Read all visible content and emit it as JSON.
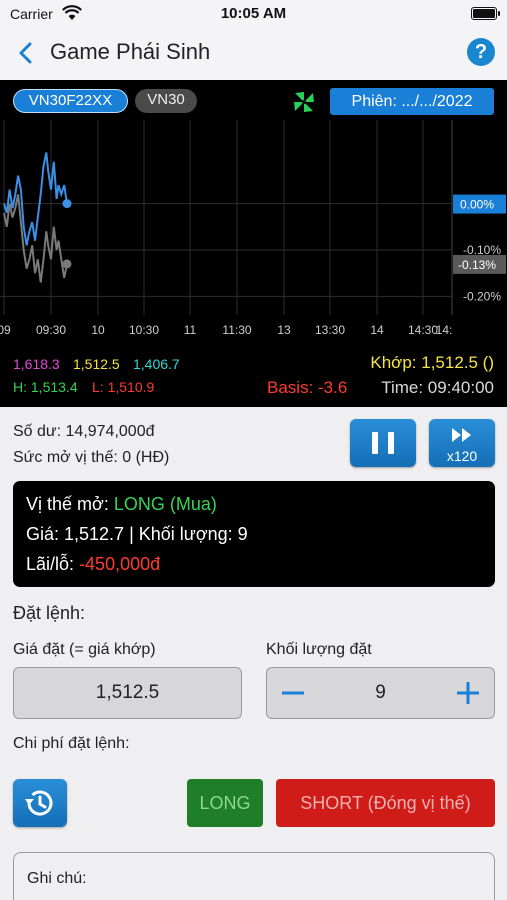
{
  "status_bar": {
    "carrier": "Carrier",
    "time": "10:05 AM"
  },
  "nav": {
    "title": "Game Phái Sinh",
    "help": "?"
  },
  "ticker": {
    "symbols": [
      "VN30F22XX",
      "VN30"
    ],
    "selected": "VN30F22XX",
    "session": "Phiên: .../.../2022"
  },
  "chart_data": {
    "type": "line",
    "x_ticks": [
      "09",
      "09:30",
      "10",
      "10:30",
      "11",
      "11:30",
      "13",
      "13:30",
      "14",
      "14:30",
      "14:"
    ],
    "y_ticks": [
      "0.00%",
      "-0.10%",
      "-0.20%"
    ],
    "last_labels": [
      "0.00%",
      "-0.13%"
    ],
    "ylim": [
      -0.24,
      0.18
    ],
    "grid": true,
    "series": [
      {
        "color": "#3b8fe6",
        "x": [
          9.0,
          9.03,
          9.06,
          9.09,
          9.12,
          9.15,
          9.18,
          9.21,
          9.24,
          9.27,
          9.3,
          9.33,
          9.36,
          9.39,
          9.42,
          9.45,
          9.47,
          9.5,
          9.53,
          9.56,
          9.58,
          9.61,
          9.64,
          9.67
        ],
        "y": [
          0.0,
          -0.02,
          0.03,
          -0.01,
          0.02,
          0.06,
          0.03,
          -0.05,
          -0.09,
          -0.06,
          -0.04,
          -0.08,
          -0.03,
          0.02,
          0.08,
          0.11,
          0.07,
          0.03,
          0.09,
          0.01,
          0.04,
          0.02,
          0.04,
          0.0
        ]
      },
      {
        "color": "#7a7a7a",
        "x": [
          9.0,
          9.03,
          9.06,
          9.09,
          9.12,
          9.15,
          9.18,
          9.21,
          9.24,
          9.27,
          9.3,
          9.33,
          9.36,
          9.39,
          9.42,
          9.45,
          9.47,
          9.5,
          9.53,
          9.56,
          9.58,
          9.61,
          9.64,
          9.67
        ],
        "y": [
          -0.02,
          -0.05,
          0.0,
          -0.03,
          -0.01,
          0.02,
          -0.04,
          -0.1,
          -0.14,
          -0.12,
          -0.09,
          -0.15,
          -0.12,
          -0.17,
          -0.12,
          -0.06,
          -0.09,
          -0.12,
          -0.05,
          -0.1,
          -0.08,
          -0.12,
          -0.16,
          -0.13
        ]
      }
    ]
  },
  "stats": {
    "ref": "1,618.3",
    "last": "1,512.5",
    "floor": "1,406.7",
    "high": "H: 1,513.4",
    "low": "L: 1,510.9",
    "khop": "Khớp: 1,512.5  ()",
    "basis": "Basis: -3.6",
    "time": "Time: 09:40:00"
  },
  "account": {
    "balance": "Số dư: 14,974,000đ",
    "open_capacity": "Sức mở vị thế: 0 (HĐ)",
    "speed": "x120"
  },
  "position": {
    "label": "Vị thế mở: ",
    "side": "LONG (Mua)",
    "price_qty": "Giá: 1,512.7 | Khối lượng: 9",
    "pl_label": "Lãi/lỗ: ",
    "pl_value": "-450,000đ"
  },
  "order": {
    "title": "Đặt lệnh:",
    "price_label": "Giá đặt (= giá khớp)",
    "price_value": "1,512.5",
    "qty_label": "Khối lượng đặt",
    "qty_value": "9",
    "cost_label": "Chi phí đặt lệnh:",
    "long": "LONG",
    "short": "SHORT (Đóng vị thế)"
  },
  "note": {
    "label": "Ghi chú:"
  },
  "colors": {
    "accent": "#1a7fd6",
    "long": "#1e7f28",
    "short": "#cf1c18"
  }
}
